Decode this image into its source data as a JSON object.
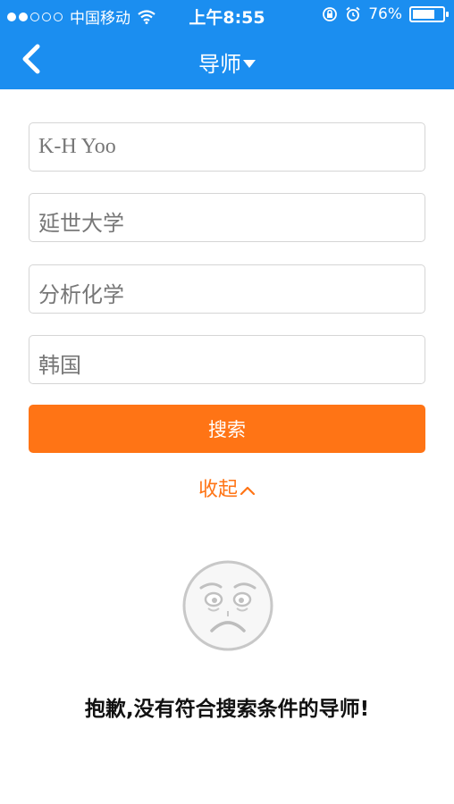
{
  "status_bar": {
    "carrier": "中国移动",
    "time": "上午8:55",
    "battery_percent": "76%",
    "battery_level": 0.76
  },
  "nav": {
    "title": "导师"
  },
  "form": {
    "name_value": "K-H Yoo",
    "university_value": "延世大学",
    "field_value": "分析化学",
    "country_value": "韩国",
    "search_label": "搜索",
    "collapse_label": "收起"
  },
  "empty_state": {
    "message": "抱歉,没有符合搜索条件的导师!"
  },
  "colors": {
    "header": "#1b8ef0",
    "accent": "#ff7415"
  }
}
